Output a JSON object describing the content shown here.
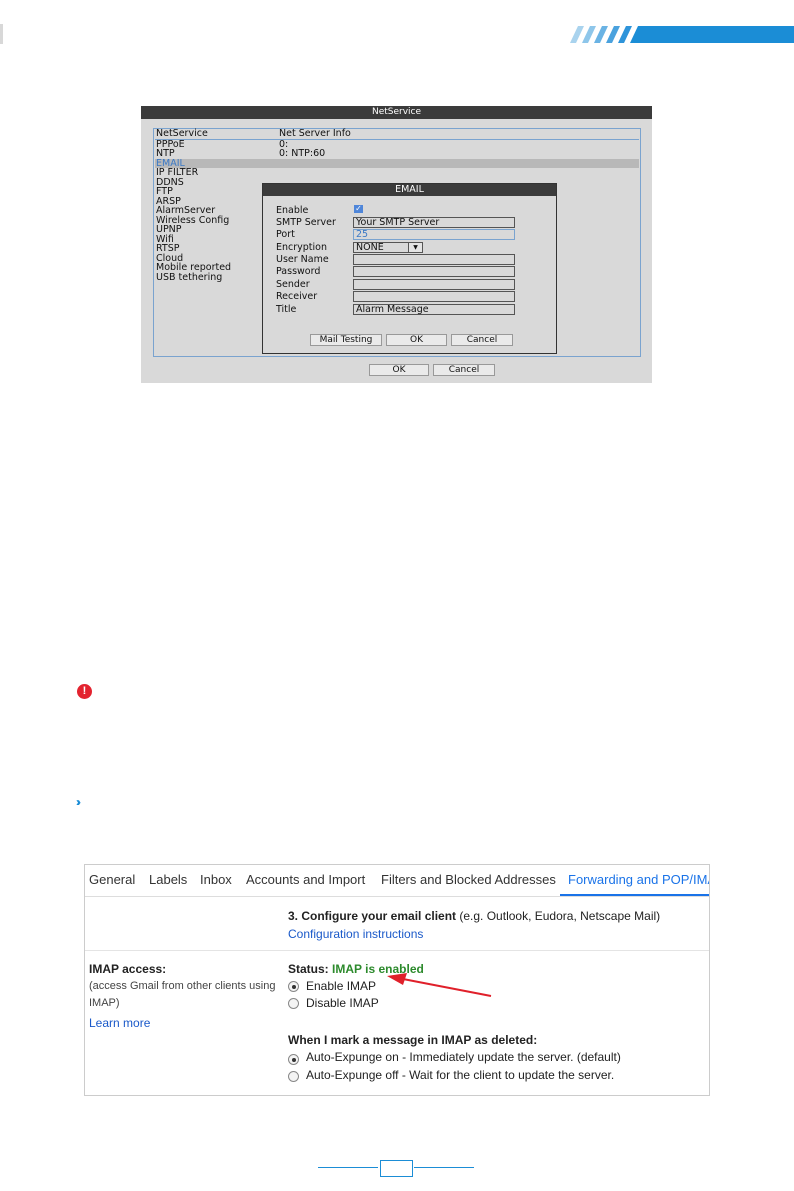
{
  "netservice": {
    "title": "NetService",
    "header": {
      "name": "NetService",
      "info": "Net Server Info"
    },
    "items": [
      {
        "name": "PPPoE",
        "info": "0:"
      },
      {
        "name": "NTP",
        "info": "0: NTP:60"
      },
      {
        "name": "EMAIL",
        "info": ""
      },
      {
        "name": "IP FILTER",
        "info": ""
      },
      {
        "name": "DDNS",
        "info": ""
      },
      {
        "name": "FTP",
        "info": ""
      },
      {
        "name": "ARSP",
        "info": ""
      },
      {
        "name": "AlarmServer",
        "info": ""
      },
      {
        "name": "Wireless Config",
        "info": ""
      },
      {
        "name": "UPNP",
        "info": ""
      },
      {
        "name": "Wifi",
        "info": ""
      },
      {
        "name": "RTSP",
        "info": ""
      },
      {
        "name": "Cloud",
        "info": ""
      },
      {
        "name": "Mobile reported",
        "info": ""
      },
      {
        "name": "USB tethering",
        "info": ""
      }
    ],
    "ok_label": "OK",
    "cancel_label": "Cancel"
  },
  "email_dialog": {
    "title": "EMAIL",
    "labels": {
      "enable": "Enable",
      "smtp_server": "SMTP Server",
      "port": "Port",
      "encryption": "Encryption",
      "user_name": "User Name",
      "password": "Password",
      "sender": "Sender",
      "receiver": "Receiver",
      "title": "Title"
    },
    "values": {
      "enable": true,
      "smtp_server": "Your SMTP Server",
      "port": "25",
      "encryption": "NONE",
      "user_name": "",
      "password": "",
      "sender": "",
      "receiver": "",
      "title": "Alarm Message"
    },
    "buttons": {
      "mail_testing": "Mail Testing",
      "ok": "OK",
      "cancel": "Cancel"
    }
  },
  "gmail": {
    "tabs": [
      "General",
      "Labels",
      "Inbox",
      "Accounts and Import",
      "Filters and Blocked Addresses",
      "Forwarding and POP/IMAP"
    ],
    "active_tab": "Forwarding and POP/IMAP",
    "configure": {
      "heading": "3. Configure your email client",
      "note": " (e.g. Outlook, Eudora, Netscape Mail)",
      "link": "Configuration instructions"
    },
    "imap": {
      "label": "IMAP access:",
      "desc_line1": "(access Gmail from other clients using",
      "desc_line2": "IMAP)",
      "learn_more": "Learn more",
      "status_label": "Status: ",
      "status_value": "IMAP is enabled",
      "options": [
        {
          "label": "Enable IMAP",
          "selected": true
        },
        {
          "label": "Disable IMAP",
          "selected": false
        }
      ]
    },
    "deleted": {
      "heading": "When I mark a message in IMAP as deleted:",
      "options": [
        {
          "label": "Auto-Expunge on - Immediately update the server. (default)",
          "selected": true
        },
        {
          "label": "Auto-Expunge off - Wait for the client to update the server.",
          "selected": false
        }
      ]
    }
  },
  "colors": {
    "accent_blue": "#1b8dd6",
    "alert_red": "#e3232f",
    "gmail_blue": "#1a73e8",
    "imap_green": "#2c8a2c",
    "arrow_red": "#e0202a"
  }
}
